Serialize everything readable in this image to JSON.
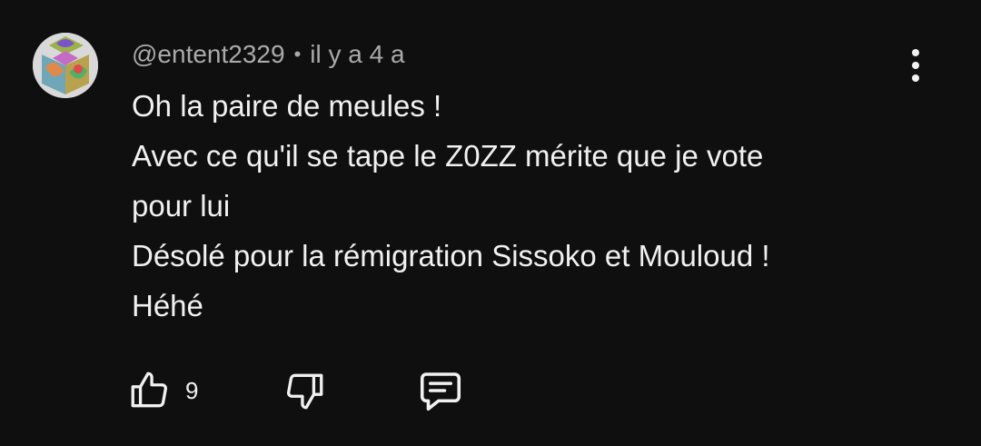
{
  "comment": {
    "author": "@entent2329",
    "separator": "•",
    "timestamp": "il y a 4 a",
    "lines": [
      "Oh la paire de meules !",
      "Avec ce qu'il se tape le Z0ZZ mérite que je vote",
      "pour lui",
      "Désolé pour la rémigration Sissoko et Mouloud !",
      "Héhé"
    ],
    "like_count": "9"
  },
  "icons": {
    "avatar": "avatar-image",
    "menu": "more-vert-icon",
    "like": "thumbs-up-icon",
    "dislike": "thumbs-down-icon",
    "reply": "comment-reply-icon"
  },
  "colors": {
    "background": "#0f0f0f",
    "text_primary": "#f1f1f1",
    "text_secondary": "#aaaaaa"
  }
}
